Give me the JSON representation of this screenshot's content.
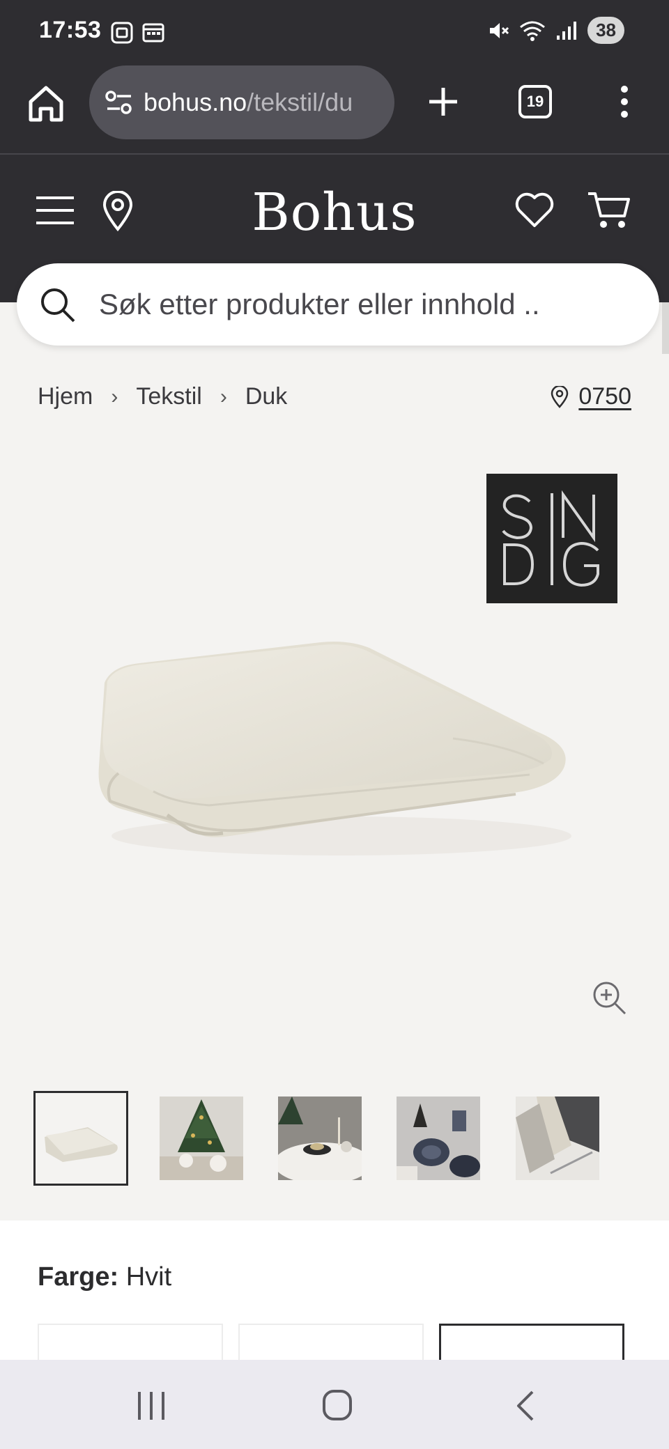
{
  "status_bar": {
    "time": "17:53",
    "battery": "38"
  },
  "browser": {
    "url_host": "bohus.no",
    "url_path": "/tekstil/du",
    "tab_count": "19"
  },
  "header": {
    "logo": "Bohus"
  },
  "search": {
    "placeholder": "Søk etter produkter eller innhold .."
  },
  "breadcrumb": {
    "items": [
      "Hjem",
      "Tekstil",
      "Duk"
    ]
  },
  "store": {
    "code": "0750"
  },
  "brand": {
    "logo_text": "SINDIG"
  },
  "thumbnails": [
    "product-folded-tablecloth",
    "christmas-table-setting",
    "round-table-setting",
    "dark-dinnerware-setting",
    "folded-napkins-cutlery"
  ],
  "color": {
    "label": "Farge:",
    "value": "Hvit"
  },
  "colors": {
    "header_bg": "#2e2d31",
    "page_bg": "#f4f3f1",
    "text": "#2c2c2e"
  }
}
